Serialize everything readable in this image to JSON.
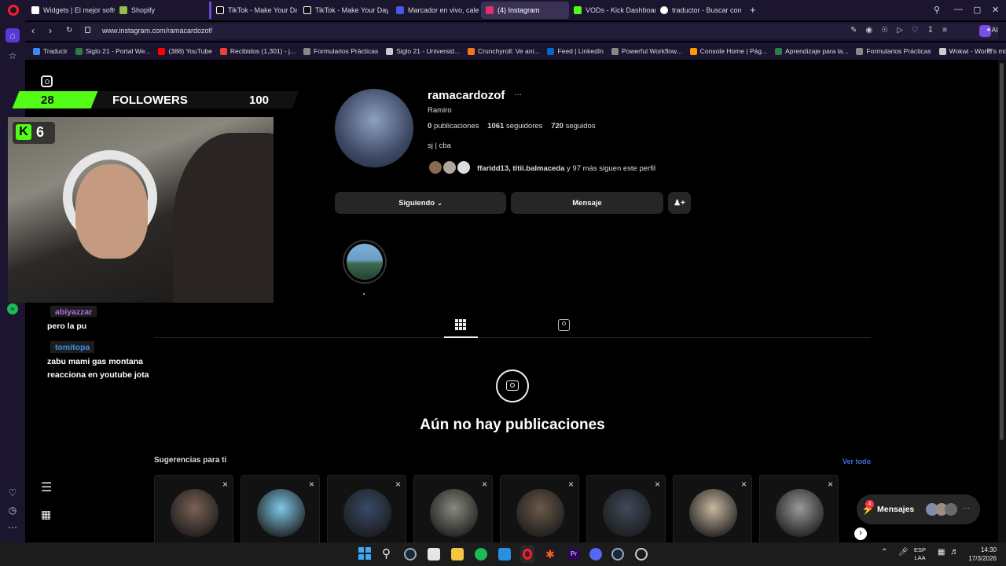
{
  "tabs": [
    {
      "label": "Widgets | El mejor softwa",
      "color": "#ffffff"
    },
    {
      "label": "Shopify",
      "color": "#95bf47"
    },
    {
      "label": "TikTok - Make Your Day",
      "color": "#ffffff"
    },
    {
      "label": "TikTok - Make Your Day",
      "color": "#ffffff"
    },
    {
      "label": "Marcador en vivo, calenda",
      "color": "#4a56e2"
    },
    {
      "label": "(4) Instagram",
      "color": "#e1306c"
    },
    {
      "label": "VODs - Kick Dashboard",
      "color": "#53fc18"
    },
    {
      "label": "traductor - Buscar con Go",
      "color": "#ffffff"
    }
  ],
  "new_tab": "+",
  "address": {
    "url": "www.instagram.com/ramacardozof/",
    "ai_label": "AI"
  },
  "bookmarks": [
    {
      "label": "Traducir",
      "color": "#4285f4"
    },
    {
      "label": "Siglo 21 - Portal We...",
      "color": "#2d7d46"
    },
    {
      "label": "(388) YouTube",
      "color": "#ff0000"
    },
    {
      "label": "Recibidos (1,301) - j...",
      "color": "#ea4335"
    },
    {
      "label": "Formularios Prácticas",
      "color": "#888888"
    },
    {
      "label": "Siglo 21 - Universid...",
      "color": "#cccccc"
    },
    {
      "label": "Crunchyroll: Ve ani...",
      "color": "#f47521"
    },
    {
      "label": "Feed | LinkedIn",
      "color": "#0a66c2"
    },
    {
      "label": "Powerful Workflow...",
      "color": "#888888"
    },
    {
      "label": "Console Home | Pág...",
      "color": "#ff9900"
    },
    {
      "label": "Aprendizaje para la...",
      "color": "#2d7d46"
    },
    {
      "label": "Formularios Prácticas",
      "color": "#888888"
    },
    {
      "label": "Wokwi - World's mo...",
      "color": "#cccccc"
    }
  ],
  "profile": {
    "username": "ramacardozof",
    "more": "···",
    "full_name": "Ramiro",
    "posts_count": "0",
    "posts_label": "publicaciones",
    "followers_count": "1061",
    "followers_label": "seguidores",
    "following_count": "720",
    "following_label": "seguidos",
    "bio": "sj | cba",
    "followed_by_names": "ffaridd13, titii.balmaceda",
    "followed_by_rest": "y 97 más siguen este perfil",
    "following_button": "Siguiendo",
    "message_button": "Mensaje"
  },
  "empty_state": {
    "title": "Aún no hay publicaciones"
  },
  "suggestions": {
    "title": "Sugerencias para ti",
    "see_all": "Ver todo",
    "close": "×",
    "count": 8
  },
  "messages_bubble": {
    "label": "Mensajes",
    "badge": "4",
    "more": "···"
  },
  "stream_overlay": {
    "followers_current": "28",
    "followers_label": "FOLLOWERS",
    "followers_goal": "100",
    "followers_progress": 0.28,
    "kick_count": "6",
    "chat": [
      {
        "user": "abiyazzar",
        "message": "pero la pu",
        "color": "#b06de0"
      },
      {
        "user": "tomitopa",
        "message": "zabu mami gas montana reacciona en youtube jota",
        "color": "#3f8fe8"
      }
    ]
  },
  "taskbar": {
    "lang_top": "ESP",
    "lang_bottom": "LAA",
    "time": "14:30",
    "date": "17/3/2026"
  },
  "colors": {
    "accent": "#4a6fd6",
    "kick_green": "#53fc18",
    "badge_red": "#ff3040"
  }
}
